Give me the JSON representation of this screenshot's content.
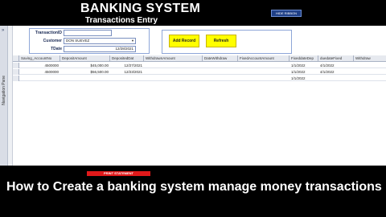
{
  "header": {
    "title": "BANKING SYSTEM",
    "subtitle": "Transactions Entry",
    "hide_ribbon_label": "HIDE RIBBON"
  },
  "nav_pane": {
    "label": "Navigation Pane"
  },
  "form": {
    "transaction_id_label": "TransactionID",
    "transaction_id_value": "",
    "customer_label": "Customer",
    "customer_value": "DON SUEVEZ",
    "tdate_label": "TDate",
    "tdate_value": "12/28/2021"
  },
  "buttons": {
    "add_record": "Add Record",
    "refresh": "Refresh",
    "print_statement": "PRINT STATEMENT"
  },
  "grid": {
    "columns": [
      "Saving_AccountNo",
      "DepositAmount",
      "DepositedDat",
      "WithdrawnAmount",
      "DateWithdraw",
      "FixedAccountAmount",
      "FixeddateDep",
      "duedateFixed",
      "Withdraw"
    ],
    "rows": [
      {
        "account": "4500000",
        "deposit": "$45,000.00",
        "deposited": "12/27/2021",
        "withdrawn": "",
        "date_withdraw": "",
        "fixed_amount": "",
        "fixed_date": "1/1/2022",
        "due_date": "4/1/2022",
        "withdraw": ""
      },
      {
        "account": "4500000",
        "deposit": "$56,500.00",
        "deposited": "12/23/2021",
        "withdrawn": "",
        "date_withdraw": "",
        "fixed_amount": "",
        "fixed_date": "1/1/2022",
        "due_date": "4/1/2022",
        "withdraw": ""
      },
      {
        "account": "",
        "deposit": "",
        "deposited": "",
        "withdrawn": "",
        "date_withdraw": "",
        "fixed_amount": "",
        "fixed_date": "1/1/2022",
        "due_date": "",
        "withdraw": ""
      }
    ]
  },
  "caption": "How to Create a banking system manage money transactions",
  "colors": {
    "button_yellow": "#ffff00",
    "print_red": "#e0191a",
    "ribbon_blue": "#1f3f86"
  }
}
